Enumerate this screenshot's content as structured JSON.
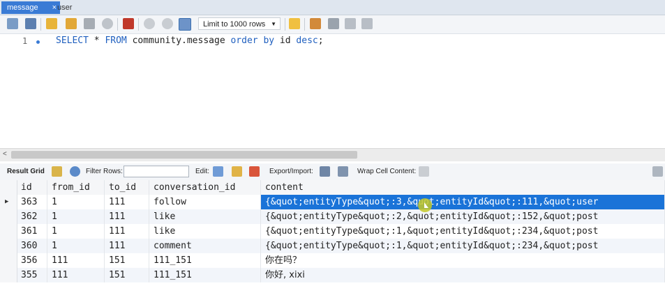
{
  "tabs": [
    {
      "label": "message",
      "close": "×"
    },
    {
      "label": "user"
    }
  ],
  "toolbar": {
    "limit_select_value": "Limit to 1000 rows",
    "icons": [
      "folder-icon",
      "save-icon",
      "lightning-icon",
      "lightning-cursor-icon",
      "magnifier-icon",
      "stop-icon",
      "stop-on-error-icon",
      "commit-icon",
      "rollback-icon",
      "autocommit-icon",
      "star-add-icon",
      "beautify-icon",
      "find-icon",
      "invisible-chars-icon",
      "wrap-icon"
    ]
  },
  "editor": {
    "line_number": "1",
    "sql_kw1": "SELECT",
    "sql_star": " * ",
    "sql_kw2": "FROM",
    "sql_table": " community.message ",
    "sql_kw3": "order by",
    "sql_col": " id ",
    "sql_kw4": "desc",
    "sql_end": ";"
  },
  "result_toolbar": {
    "result_grid": "Result Grid",
    "filter_rows": "Filter Rows:",
    "edit": "Edit:",
    "export_import": "Export/Import:",
    "wrap_cell": "Wrap Cell Content:"
  },
  "grid": {
    "columns": [
      "id",
      "from_id",
      "to_id",
      "conversation_id",
      "content"
    ],
    "rows": [
      [
        "363",
        "1",
        "111",
        "follow",
        "{&quot;entityType&quot;:3,&quot;entityId&quot;:111,&quot;user"
      ],
      [
        "362",
        "1",
        "111",
        "like",
        "{&quot;entityType&quot;:2,&quot;entityId&quot;:152,&quot;post"
      ],
      [
        "361",
        "1",
        "111",
        "like",
        "{&quot;entityType&quot;:1,&quot;entityId&quot;:234,&quot;post"
      ],
      [
        "360",
        "1",
        "111",
        "comment",
        "{&quot;entityType&quot;:1,&quot;entityId&quot;:234,&quot;post"
      ],
      [
        "356",
        "111",
        "151",
        "111_151",
        "你在吗？"
      ],
      [
        "355",
        "111",
        "151",
        "111_151",
        "你好, xixi"
      ]
    ]
  }
}
